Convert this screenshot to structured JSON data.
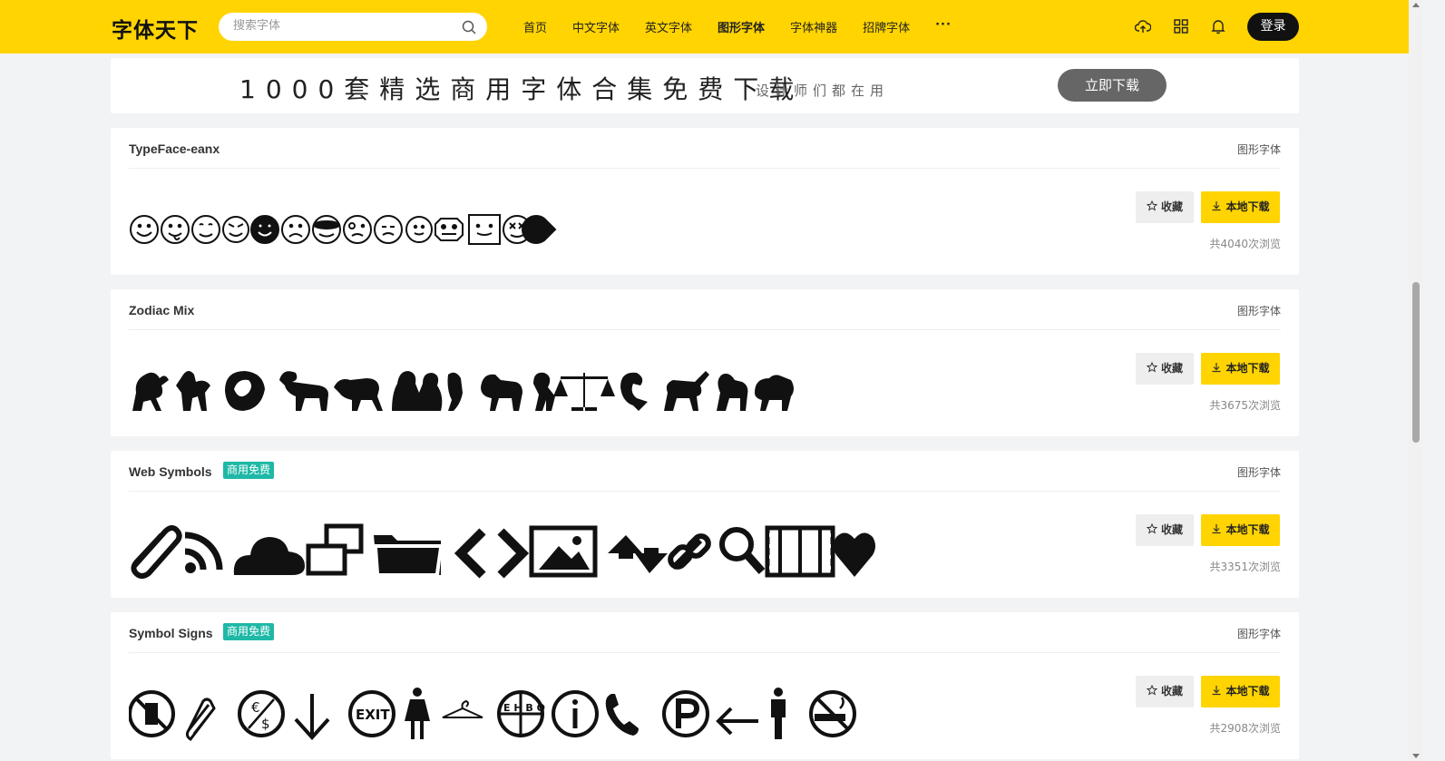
{
  "header": {
    "logo": "字体天下",
    "search_placeholder": "搜索字体",
    "nav": [
      "首页",
      "中文字体",
      "英文字体",
      "图形字体",
      "字体神器",
      "招牌字体",
      "···"
    ],
    "active_nav": "图形字体",
    "login_label": "登录",
    "icons": [
      "upload-cloud-icon",
      "grid-icon",
      "bell-icon"
    ]
  },
  "banner": {
    "main_text": "1000套精选商用字体合集免费下载",
    "sub_text": "设计师们都在用",
    "button_label": "立即下载"
  },
  "fonts": [
    {
      "name": "TypeFace-eanx",
      "badge": "",
      "category": "图形字体",
      "preview": "smiley-faces",
      "fav_label": "收藏",
      "download_label": "本地下载",
      "views": "共4040次浏览"
    },
    {
      "name": "Zodiac Mix",
      "badge": "",
      "category": "图形字体",
      "preview": "zodiac-figures",
      "fav_label": "收藏",
      "download_label": "本地下载",
      "views": "共3675次浏览"
    },
    {
      "name": "Web Symbols",
      "badge": "商用免费",
      "category": "图形字体",
      "preview": "web-icons",
      "fav_label": "收藏",
      "download_label": "本地下载",
      "views": "共3351次浏览"
    },
    {
      "name": "Symbol Signs",
      "badge": "商用免费",
      "category": "图形字体",
      "preview": "public-signs",
      "fav_label": "收藏",
      "download_label": "本地下载",
      "views": "共2908次浏览"
    }
  ],
  "preview_texts": {
    "exit": "EXIT",
    "ehbo": "E H B O"
  },
  "colors": {
    "brand": "#ffd400",
    "badge": "#1fb8a6",
    "dark_button": "#111111"
  }
}
